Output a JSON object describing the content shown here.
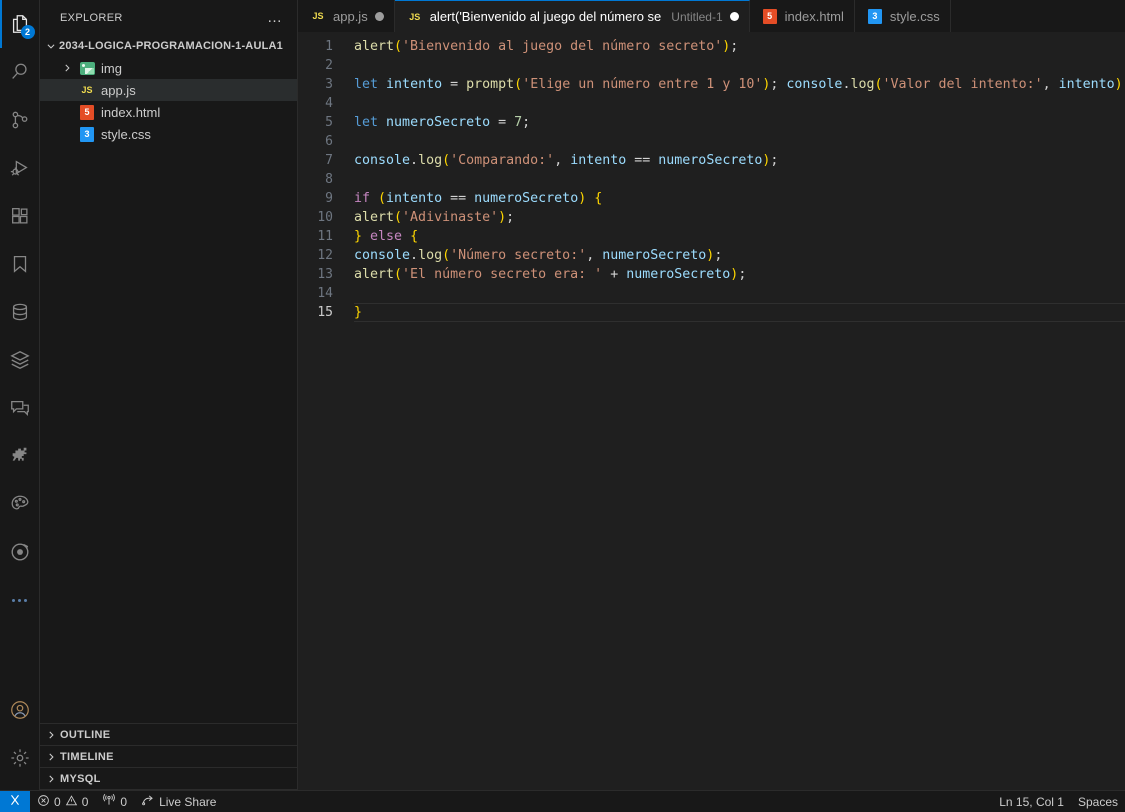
{
  "activitybar": {
    "items": [
      {
        "name": "explorer",
        "icon": "files-icon",
        "badge": "2",
        "active": true
      },
      {
        "name": "search",
        "icon": "search-icon",
        "badge": null,
        "active": false
      },
      {
        "name": "source-control",
        "icon": "source-control-icon",
        "badge": null,
        "active": false
      },
      {
        "name": "run-and-debug",
        "icon": "run-debug-icon",
        "badge": null,
        "active": false
      },
      {
        "name": "extensions",
        "icon": "extensions-icon",
        "badge": null,
        "active": false
      },
      {
        "name": "bookmarks",
        "icon": "bookmark-icon",
        "badge": null,
        "active": false
      },
      {
        "name": "database",
        "icon": "database-icon",
        "badge": null,
        "active": false
      },
      {
        "name": "layers",
        "icon": "layers-icon",
        "badge": null,
        "active": false
      },
      {
        "name": "comments",
        "icon": "comment-icon",
        "badge": null,
        "active": false
      },
      {
        "name": "dinosaur",
        "icon": "dinosaur-icon",
        "badge": null,
        "active": false
      },
      {
        "name": "theme-palette",
        "icon": "palette-icon",
        "badge": null,
        "active": false
      },
      {
        "name": "ionic",
        "icon": "target-circle-icon",
        "badge": null,
        "active": false
      },
      {
        "name": "additional-views",
        "icon": "ellipsis-icon",
        "badge": null,
        "active": false
      }
    ],
    "bottom": [
      {
        "name": "accounts",
        "icon": "account-icon"
      },
      {
        "name": "manage",
        "icon": "gear-icon"
      }
    ]
  },
  "sidebar": {
    "title": "EXPLORER",
    "more_label": "…",
    "root_folder": "2034-LOGICA-PROGRAMACION-1-AULA1",
    "tree": [
      {
        "label": "img",
        "type": "folder",
        "icon": "image-folder-icon",
        "expanded": false,
        "selected": false
      },
      {
        "label": "app.js",
        "type": "file",
        "icon": "js-icon",
        "icon_text": "JS",
        "selected": true
      },
      {
        "label": "index.html",
        "type": "file",
        "icon": "html-icon",
        "icon_text": "5",
        "selected": false
      },
      {
        "label": "style.css",
        "type": "file",
        "icon": "css-icon",
        "icon_text": "3",
        "selected": false
      }
    ],
    "sections": [
      "OUTLINE",
      "TIMELINE",
      "MYSQL"
    ]
  },
  "tabs": [
    {
      "label": "app.js",
      "description": "",
      "icon": "js-icon",
      "icon_text": "JS",
      "active": false,
      "dirty": true
    },
    {
      "label": "alert('Bienvenido al juego del número se",
      "description": "Untitled-1",
      "icon": "js-icon",
      "icon_text": "JS",
      "active": true,
      "dirty": true
    },
    {
      "label": "index.html",
      "description": "",
      "icon": "html-icon",
      "icon_text": "5",
      "active": false,
      "dirty": false
    },
    {
      "label": "style.css",
      "description": "",
      "icon": "css-icon",
      "icon_text": "3",
      "active": false,
      "dirty": false
    }
  ],
  "editor": {
    "current_line": 15,
    "lines": [
      {
        "n": "1",
        "tokens": [
          {
            "t": "alert",
            "c": "fn"
          },
          {
            "t": "(",
            "c": "pn"
          },
          {
            "t": "'Bienvenido al juego del número secreto'",
            "c": "str"
          },
          {
            "t": ")",
            "c": "pn"
          },
          {
            "t": ";",
            "c": "op"
          }
        ]
      },
      {
        "n": "2",
        "tokens": []
      },
      {
        "n": "3",
        "tokens": [
          {
            "t": "let",
            "c": "kw"
          },
          {
            "t": " ",
            "c": "op"
          },
          {
            "t": "intento",
            "c": "var"
          },
          {
            "t": " = ",
            "c": "op"
          },
          {
            "t": "prompt",
            "c": "fn"
          },
          {
            "t": "(",
            "c": "pn"
          },
          {
            "t": "'Elige un número entre 1 y 10'",
            "c": "str"
          },
          {
            "t": ")",
            "c": "pn"
          },
          {
            "t": "; ",
            "c": "op"
          },
          {
            "t": "console",
            "c": "var"
          },
          {
            "t": ".",
            "c": "op"
          },
          {
            "t": "log",
            "c": "fn"
          },
          {
            "t": "(",
            "c": "pn"
          },
          {
            "t": "'Valor del intento:'",
            "c": "str"
          },
          {
            "t": ", ",
            "c": "op"
          },
          {
            "t": "intento",
            "c": "var"
          },
          {
            "t": ")",
            "c": "pn"
          },
          {
            "t": ";",
            "c": "op"
          }
        ]
      },
      {
        "n": "4",
        "tokens": []
      },
      {
        "n": "5",
        "tokens": [
          {
            "t": "let",
            "c": "kw"
          },
          {
            "t": " ",
            "c": "op"
          },
          {
            "t": "numeroSecreto",
            "c": "var"
          },
          {
            "t": " = ",
            "c": "op"
          },
          {
            "t": "7",
            "c": "num"
          },
          {
            "t": ";",
            "c": "op"
          }
        ]
      },
      {
        "n": "6",
        "tokens": []
      },
      {
        "n": "7",
        "tokens": [
          {
            "t": "console",
            "c": "var"
          },
          {
            "t": ".",
            "c": "op"
          },
          {
            "t": "log",
            "c": "fn"
          },
          {
            "t": "(",
            "c": "pn"
          },
          {
            "t": "'Comparando:'",
            "c": "str"
          },
          {
            "t": ", ",
            "c": "op"
          },
          {
            "t": "intento",
            "c": "var"
          },
          {
            "t": " == ",
            "c": "op"
          },
          {
            "t": "numeroSecreto",
            "c": "var"
          },
          {
            "t": ")",
            "c": "pn"
          },
          {
            "t": ";",
            "c": "op"
          }
        ]
      },
      {
        "n": "8",
        "tokens": []
      },
      {
        "n": "9",
        "tokens": [
          {
            "t": "if",
            "c": "ctrl"
          },
          {
            "t": " ",
            "c": "op"
          },
          {
            "t": "(",
            "c": "pn"
          },
          {
            "t": "intento",
            "c": "var"
          },
          {
            "t": " == ",
            "c": "op"
          },
          {
            "t": "numeroSecreto",
            "c": "var"
          },
          {
            "t": ")",
            "c": "pn"
          },
          {
            "t": " ",
            "c": "op"
          },
          {
            "t": "{",
            "c": "pn"
          }
        ]
      },
      {
        "n": "10",
        "tokens": [
          {
            "t": "alert",
            "c": "fn"
          },
          {
            "t": "(",
            "c": "pn"
          },
          {
            "t": "'Adivinaste'",
            "c": "str"
          },
          {
            "t": ")",
            "c": "pn"
          },
          {
            "t": ";",
            "c": "op"
          }
        ]
      },
      {
        "n": "11",
        "tokens": [
          {
            "t": "}",
            "c": "pn"
          },
          {
            "t": " ",
            "c": "op"
          },
          {
            "t": "else",
            "c": "ctrl"
          },
          {
            "t": " ",
            "c": "op"
          },
          {
            "t": "{",
            "c": "pn"
          }
        ]
      },
      {
        "n": "12",
        "tokens": [
          {
            "t": "console",
            "c": "var"
          },
          {
            "t": ".",
            "c": "op"
          },
          {
            "t": "log",
            "c": "fn"
          },
          {
            "t": "(",
            "c": "pn"
          },
          {
            "t": "'Número secreto:'",
            "c": "str"
          },
          {
            "t": ", ",
            "c": "op"
          },
          {
            "t": "numeroSecreto",
            "c": "var"
          },
          {
            "t": ")",
            "c": "pn"
          },
          {
            "t": ";",
            "c": "op"
          }
        ]
      },
      {
        "n": "13",
        "tokens": [
          {
            "t": "alert",
            "c": "fn"
          },
          {
            "t": "(",
            "c": "pn"
          },
          {
            "t": "'El número secreto era: '",
            "c": "str"
          },
          {
            "t": " + ",
            "c": "op"
          },
          {
            "t": "numeroSecreto",
            "c": "var"
          },
          {
            "t": ")",
            "c": "pn"
          },
          {
            "t": ";",
            "c": "op"
          }
        ]
      },
      {
        "n": "14",
        "tokens": []
      },
      {
        "n": "15",
        "tokens": [
          {
            "t": "}",
            "c": "pn"
          }
        ]
      }
    ]
  },
  "statusbar": {
    "remote_icon": "remote-window-icon",
    "errors": "0",
    "warnings": "0",
    "ports": "0",
    "live_share": "Live Share",
    "cursor_position": "Ln 15, Col 1",
    "indentation": "Spaces"
  },
  "colors": {
    "accent": "#0078d4",
    "editor_bg": "#1f1f1f",
    "chrome_bg": "#181818",
    "selection_bg": "#2a2d2e"
  }
}
